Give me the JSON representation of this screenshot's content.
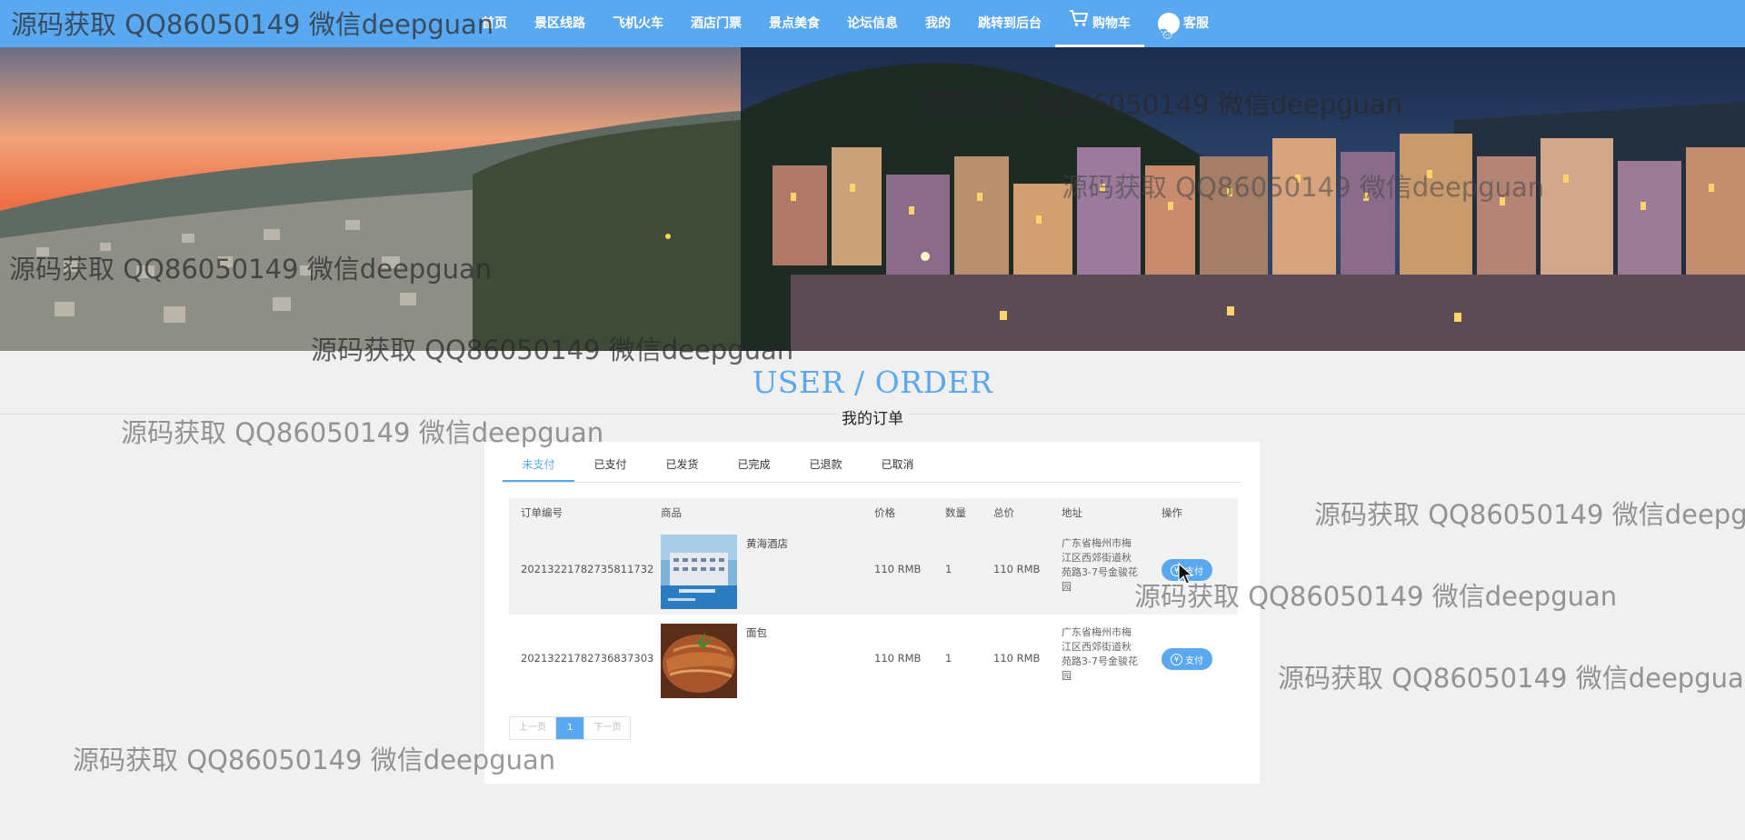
{
  "nav": {
    "items": [
      {
        "label": "首页"
      },
      {
        "label": "景区线路"
      },
      {
        "label": "飞机火车"
      },
      {
        "label": "酒店门票"
      },
      {
        "label": "景点美食"
      },
      {
        "label": "论坛信息"
      },
      {
        "label": "我的"
      },
      {
        "label": "跳转到后台"
      },
      {
        "label": "购物车",
        "icon": "cart-icon",
        "active": true
      },
      {
        "label": "客服",
        "icon": "customer-service-icon"
      }
    ]
  },
  "page": {
    "title_en": "USER / ORDER",
    "title_cn": "我的订单"
  },
  "orders": {
    "tabs": [
      "未支付",
      "已支付",
      "已发货",
      "已完成",
      "已退款",
      "已取消"
    ],
    "active_tab": "未支付",
    "columns": {
      "no": "订单编号",
      "goods": "商品",
      "price": "价格",
      "qty": "数量",
      "total": "总价",
      "addr": "地址",
      "op": "操作"
    },
    "rows": [
      {
        "no": "20213221782735811732",
        "goods": "黄海酒店",
        "price": "110 RMB",
        "qty": "1",
        "total": "110 RMB",
        "addr": "广东省梅州市梅江区西郊街道秋苑路3-7号金骏花园",
        "action": "支付"
      },
      {
        "no": "20213221782736837303",
        "goods": "面包",
        "price": "110 RMB",
        "qty": "1",
        "total": "110 RMB",
        "addr": "广东省梅州市梅江区西郊街道秋苑路3-7号金骏花园",
        "action": "支付"
      }
    ],
    "pager": {
      "prev": "上一页",
      "current": "1",
      "next": "下一页"
    }
  },
  "watermark": "源码获取 QQ86050149 微信deepguan",
  "colors": {
    "accent": "#5aa8ef",
    "background": "#f0f0f0"
  }
}
